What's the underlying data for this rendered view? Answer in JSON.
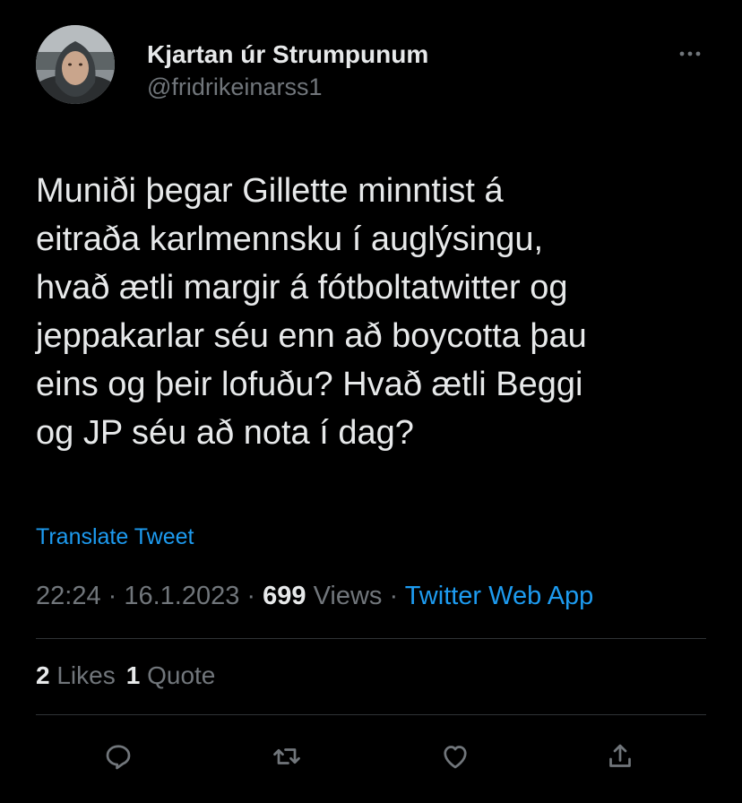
{
  "author": {
    "display_name": "Kjartan úr Strumpunum",
    "handle": "@fridrikeinarss1",
    "avatar_icon": "profile-photo"
  },
  "tweet": {
    "lines": [
      "Muniði þegar Gillette minntist á",
      "eitraða karlmennsku í auglýsingu,",
      "hvað ætli margir á fótboltatwitter og",
      "jeppakarlar séu enn að boycotta þau",
      "eins og þeir lofuðu? Hvað ætli Beggi",
      "og JP séu að nota í dag?"
    ],
    "translate_label": "Translate Tweet"
  },
  "meta": {
    "time": "22:24",
    "sep1": " · ",
    "date": "16.1.2023",
    "sep2": " · ",
    "views_count": "699",
    "views_label": " Views",
    "sep3": " · ",
    "source": "Twitter Web App"
  },
  "stats": {
    "likes_count": "2",
    "likes_label": "Likes",
    "quotes_count": "1",
    "quotes_label": "Quote"
  },
  "actions": {
    "reply_icon": "reply-icon",
    "retweet_icon": "retweet-icon",
    "like_icon": "heart-icon",
    "share_icon": "share-icon",
    "more_icon": "more-icon"
  },
  "colors": {
    "background": "#000000",
    "text": "#e7e9ea",
    "secondary": "#71767b",
    "accent": "#1d9bf0",
    "divider": "#2f3336"
  }
}
